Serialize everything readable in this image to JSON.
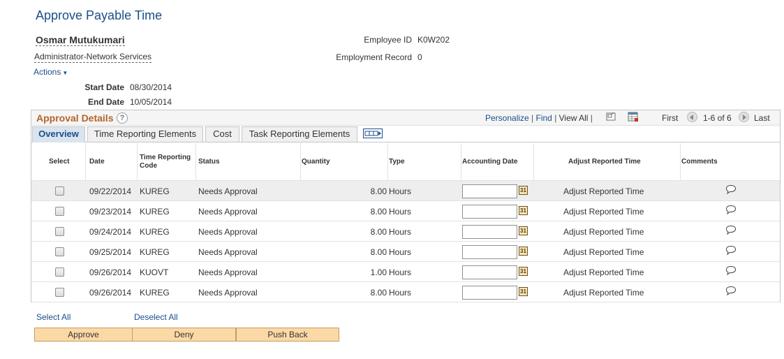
{
  "page": {
    "title": "Approve Payable Time"
  },
  "employee": {
    "name": "Osmar Mutukumari",
    "job": "Administrator-Network Services",
    "id_label": "Employee ID",
    "id_value": "K0W202",
    "record_label": "Employment Record",
    "record_value": "0",
    "start_label": "Start Date",
    "start_value": "08/30/2014",
    "end_label": "End Date",
    "end_value": "10/05/2014"
  },
  "actions": {
    "label": "Actions"
  },
  "grid": {
    "title": "Approval Details",
    "personalize": "Personalize",
    "find": "Find",
    "view_all": "View All",
    "first": "First",
    "range": "1-6 of 6",
    "last": "Last",
    "tabs": [
      {
        "label": "Overview"
      },
      {
        "label": "Time Reporting Elements"
      },
      {
        "label": "Cost"
      },
      {
        "label": "Task Reporting Elements"
      }
    ],
    "columns": {
      "select": "Select",
      "date": "Date",
      "trc_line1": "Time Reporting",
      "trc_line2": "Code",
      "status": "Status",
      "quantity": "Quantity",
      "type": "Type",
      "accounting_date": "Accounting Date",
      "adjust": "Adjust Reported Time",
      "comments": "Comments"
    },
    "rows": [
      {
        "date": "09/22/2014",
        "trc": "KUREG",
        "status": "Needs Approval",
        "quantity": "8.00",
        "type": "Hours",
        "adjust": "Adjust Reported Time"
      },
      {
        "date": "09/23/2014",
        "trc": "KUREG",
        "status": "Needs Approval",
        "quantity": "8.00",
        "type": "Hours",
        "adjust": "Adjust Reported Time"
      },
      {
        "date": "09/24/2014",
        "trc": "KUREG",
        "status": "Needs Approval",
        "quantity": "8.00",
        "type": "Hours",
        "adjust": "Adjust Reported Time"
      },
      {
        "date": "09/25/2014",
        "trc": "KUREG",
        "status": "Needs Approval",
        "quantity": "8.00",
        "type": "Hours",
        "adjust": "Adjust Reported Time"
      },
      {
        "date": "09/26/2014",
        "trc": "KUOVT",
        "status": "Needs Approval",
        "quantity": "1.00",
        "type": "Hours",
        "adjust": "Adjust Reported Time"
      },
      {
        "date": "09/26/2014",
        "trc": "KUREG",
        "status": "Needs Approval",
        "quantity": "8.00",
        "type": "Hours",
        "adjust": "Adjust Reported Time"
      }
    ]
  },
  "selection": {
    "select_all": "Select All",
    "deselect_all": "Deselect All"
  },
  "buttons": {
    "approve": "Approve",
    "deny": "Deny",
    "push_back": "Push Back"
  },
  "colors": {
    "link": "#1a4e8a",
    "title": "#1a4e8a",
    "grid_title": "#b4642a",
    "button": "#fbd9a6",
    "row_highlight": "#eeeeee"
  }
}
